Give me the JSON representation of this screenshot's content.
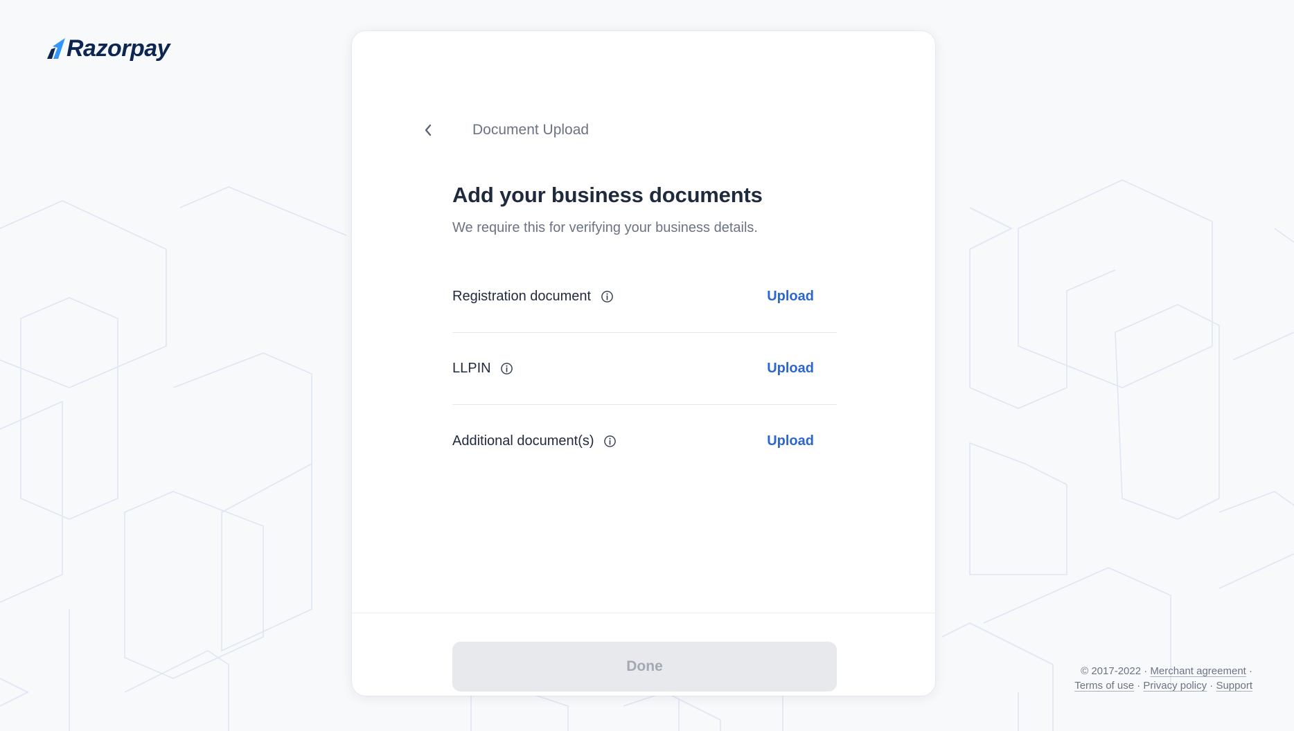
{
  "brand": {
    "name": "Razorpay",
    "color": "#0c2651",
    "accent": "#3395ff"
  },
  "header": {
    "back_icon": "chevron-left-icon",
    "title": "Document Upload"
  },
  "main": {
    "heading": "Add your business documents",
    "subheading": "We require this for verifying your business details.",
    "documents": [
      {
        "label": "Registration document",
        "info_icon": "info-icon",
        "action": "Upload"
      },
      {
        "label": "LLPIN",
        "info_icon": "info-icon",
        "action": "Upload"
      },
      {
        "label": "Additional document(s)",
        "info_icon": "info-icon",
        "action": "Upload"
      }
    ],
    "link_color": "#2c66d1"
  },
  "footer": {
    "done_label": "Done",
    "done_disabled": true
  },
  "legal": {
    "copyright": "© 2017-2022 ·",
    "merchant_agreement": "Merchant agreement",
    "sep1": "·",
    "terms": "Terms of use",
    "sep2": " ·",
    "privacy": "Privacy policy",
    "sep3": "·",
    "support": "Support"
  }
}
